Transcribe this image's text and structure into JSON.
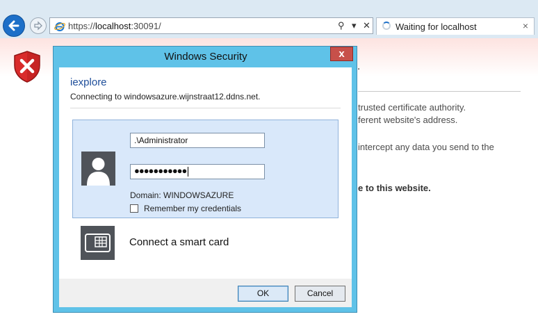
{
  "browser": {
    "url_prefix": "https://",
    "url_host": "localhost",
    "url_rest": ":30091/",
    "tab_title": "Waiting for localhost",
    "tab_close": "×",
    "search_glyph": "⚲",
    "dropdown_glyph": "▾",
    "stop_glyph": "✕"
  },
  "page": {
    "dot": ".",
    "lines": [
      "trusted certificate authority.",
      "ferent website's address.",
      "intercept any data you send to the"
    ],
    "bold_line": "e to this website."
  },
  "dialog": {
    "title": "Windows Security",
    "close": "x",
    "app_name": "iexplore",
    "connecting": "Connecting to windowsazure.wijnstraat12.ddns.net.",
    "username_value": ".\\Administrator",
    "password_mask": "●●●●●●●●●●●",
    "domain_label": "Domain: WINDOWSAZURE",
    "remember_label": "Remember my credentials",
    "remember_checked": false,
    "smart_card_label": "Connect a smart card",
    "ok_label": "OK",
    "cancel_label": "Cancel"
  },
  "colors": {
    "dialog_frame": "#5fc2e8",
    "close_button": "#c7504a",
    "credential_tile": "#d9e8fa",
    "link_blue": "#1e4e9a",
    "error_red": "#d92b2b"
  },
  "icons": [
    "back-icon",
    "forward-icon",
    "ie-icon",
    "search-icon",
    "loading-icon",
    "error-shield-icon",
    "user-avatar-icon",
    "smart-card-icon"
  ]
}
